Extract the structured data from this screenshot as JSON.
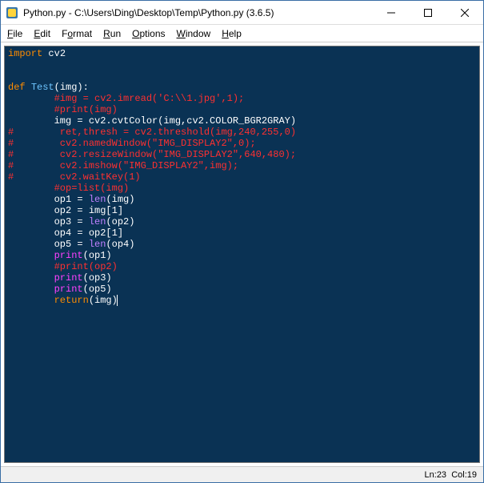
{
  "window": {
    "title": "Python.py - C:\\Users\\Ding\\Desktop\\Temp\\Python.py (3.6.5)"
  },
  "menu": {
    "file": "File",
    "edit": "Edit",
    "format": "Format",
    "run": "Run",
    "options": "Options",
    "window": "Window",
    "help": "Help"
  },
  "status": {
    "ln_label": "Ln: ",
    "ln": "23",
    "col_label": "Col: ",
    "col": "19"
  },
  "code": {
    "lines": [
      [
        {
          "c": "kw",
          "t": "import"
        },
        {
          "c": "id",
          "t": " cv2"
        }
      ],
      [],
      [],
      [
        {
          "c": "kw",
          "t": "def"
        },
        {
          "c": "id",
          "t": " "
        },
        {
          "c": "blue",
          "t": "Test"
        },
        {
          "c": "id",
          "t": "(img):"
        }
      ],
      [
        {
          "c": "id",
          "t": "        "
        },
        {
          "c": "cmt",
          "t": "#img = cv2.imread('C:\\\\1.jpg',1);"
        }
      ],
      [
        {
          "c": "id",
          "t": "        "
        },
        {
          "c": "cmt",
          "t": "#print(img)"
        }
      ],
      [
        {
          "c": "id",
          "t": "        img = cv2.cvtColor(img,cv2.COLOR_BGR2GRAY)"
        }
      ],
      [
        {
          "c": "cmt",
          "t": "#        ret,thresh = cv2.threshold(img,240,255,0)"
        }
      ],
      [
        {
          "c": "cmt",
          "t": "#        cv2.namedWindow(\"IMG_DISPLAY2\",0);"
        }
      ],
      [
        {
          "c": "cmt",
          "t": "#        cv2.resizeWindow(\"IMG_DISPLAY2\",640,480);"
        }
      ],
      [
        {
          "c": "cmt",
          "t": "#        cv2.imshow(\"IMG_DISPLAY2\",img);"
        }
      ],
      [
        {
          "c": "cmt",
          "t": "#        cv2.waitKey(1)"
        }
      ],
      [
        {
          "c": "id",
          "t": "        "
        },
        {
          "c": "cmt",
          "t": "#op=list(img)"
        }
      ],
      [
        {
          "c": "id",
          "t": "        op1 = "
        },
        {
          "c": "fn",
          "t": "len"
        },
        {
          "c": "id",
          "t": "(img)"
        }
      ],
      [
        {
          "c": "id",
          "t": "        op2 = img[1]"
        }
      ],
      [
        {
          "c": "id",
          "t": "        op3 = "
        },
        {
          "c": "fn",
          "t": "len"
        },
        {
          "c": "id",
          "t": "(op2)"
        }
      ],
      [
        {
          "c": "id",
          "t": "        op4 = op2[1]"
        }
      ],
      [
        {
          "c": "id",
          "t": "        op5 = "
        },
        {
          "c": "fn",
          "t": "len"
        },
        {
          "c": "id",
          "t": "(op4)"
        }
      ],
      [
        {
          "c": "id",
          "t": "        "
        },
        {
          "c": "mag",
          "t": "print"
        },
        {
          "c": "id",
          "t": "(op1)"
        }
      ],
      [
        {
          "c": "id",
          "t": "        "
        },
        {
          "c": "cmt",
          "t": "#print(op2)"
        }
      ],
      [
        {
          "c": "id",
          "t": "        "
        },
        {
          "c": "mag",
          "t": "print"
        },
        {
          "c": "id",
          "t": "(op3)"
        }
      ],
      [
        {
          "c": "id",
          "t": "        "
        },
        {
          "c": "mag",
          "t": "print"
        },
        {
          "c": "id",
          "t": "(op5)"
        }
      ],
      [
        {
          "c": "id",
          "t": "        "
        },
        {
          "c": "kw",
          "t": "return"
        },
        {
          "c": "id",
          "t": "(img)"
        },
        {
          "c": "caret",
          "t": ""
        }
      ]
    ]
  }
}
